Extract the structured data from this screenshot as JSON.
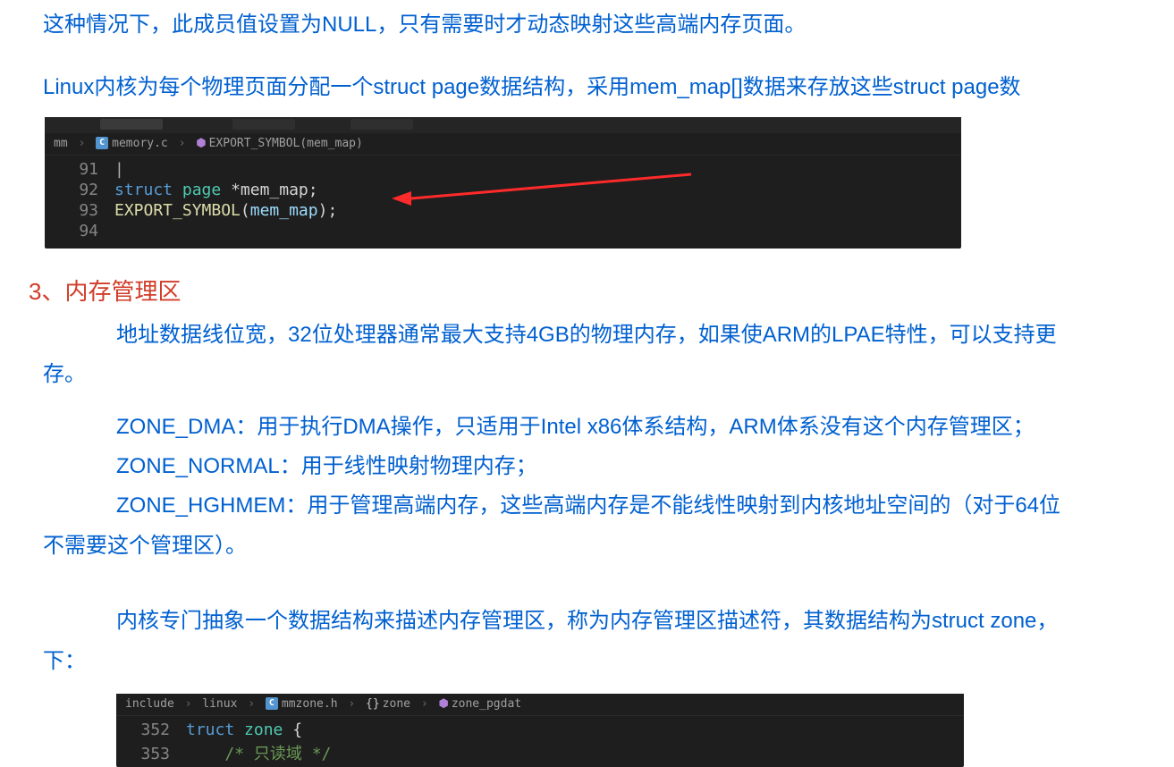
{
  "para_top": "这种情况下，此成员值设置为NULL，只有需要时才动态映射这些高端内存页面。",
  "para_linux": "Linux内核为每个物理页面分配一个struct page数据结构，采用mem_map[]数据来存放这些struct page数",
  "code1": {
    "breadcrumb": {
      "folder": "mm",
      "file": "memory.c",
      "symbol": "EXPORT_SYMBOL(mem_map)"
    },
    "lines": {
      "91": {
        "num": "91",
        "content": "|"
      },
      "92": {
        "num": "92",
        "kw_struct": "struct",
        "kw_page": "page",
        "star_var": "*mem_map",
        "semi": ";"
      },
      "93": {
        "num": "93",
        "call": "EXPORT_SYMBOL",
        "open": "(",
        "arg": "mem_map",
        "close": ")",
        "semi": ";"
      },
      "94": {
        "num": "94"
      }
    }
  },
  "heading3": "3、内存管理区",
  "para_addr1": "地址数据线位宽，32位处理器通常最大支持4GB的物理内存，如果使ARM的LPAE特性，可以支持更",
  "para_addr2": "存。",
  "zone_dma": "ZONE_DMA：用于执行DMA操作，只适用于Intel x86体系结构，ARM体系没有这个内存管理区；",
  "zone_normal": "ZONE_NORMAL：用于线性映射物理内存；",
  "zone_high1": "ZONE_HGHMEM：用于管理高端内存，这些高端内存是不能线性映射到内核地址空间的（对于64位",
  "zone_high2": "不需要这个管理区）。",
  "para_struct1": "内核专门抽象一个数据结构来描述内存管理区，称为内存管理区描述符，其数据结构为struct zone，",
  "para_struct2": "下：",
  "code2": {
    "breadcrumb": {
      "p1": "include",
      "p2": "linux",
      "file": "mmzone.h",
      "sym1": "zone",
      "sym2": "zone_pgdat"
    },
    "lines": {
      "352": {
        "num": "352",
        "kw": "truct",
        "type": "zone",
        "brace": " {"
      },
      "353": {
        "num": "353",
        "comment": "/* 只读域 */"
      }
    }
  }
}
